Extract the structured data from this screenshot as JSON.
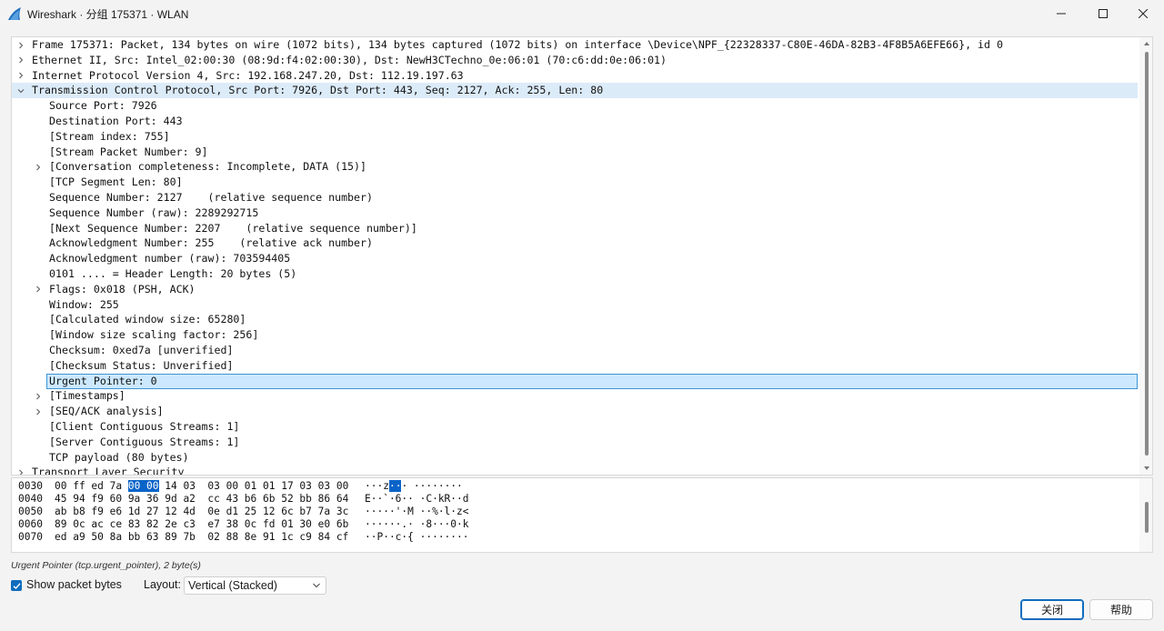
{
  "window": {
    "title": "Wireshark · 分组 175371 · WLAN",
    "accent_color": "#0f6cbd",
    "selection_color": "#cce8ff"
  },
  "tree": {
    "rows": [
      {
        "indent": 0,
        "expander": "right",
        "state": "none",
        "text": "Frame 175371: Packet, 134 bytes on wire (1072 bits), 134 bytes captured (1072 bits) on interface \\Device\\NPF_{22328337-C80E-46DA-82B3-4F8B5A6EFE66}, id 0"
      },
      {
        "indent": 0,
        "expander": "right",
        "state": "none",
        "text": "Ethernet II, Src: Intel_02:00:30 (08:9d:f4:02:00:30), Dst: NewH3CTechno_0e:06:01 (70:c6:dd:0e:06:01)"
      },
      {
        "indent": 0,
        "expander": "right",
        "state": "none",
        "text": "Internet Protocol Version 4, Src: 192.168.247.20, Dst: 112.19.197.63"
      },
      {
        "indent": 0,
        "expander": "down",
        "state": "hl",
        "text": "Transmission Control Protocol, Src Port: 7926, Dst Port: 443, Seq: 2127, Ack: 255, Len: 80"
      },
      {
        "indent": 1,
        "expander": "none",
        "state": "none",
        "text": "Source Port: 7926"
      },
      {
        "indent": 1,
        "expander": "none",
        "state": "none",
        "text": "Destination Port: 443"
      },
      {
        "indent": 1,
        "expander": "none",
        "state": "none",
        "text": "[Stream index: 755]"
      },
      {
        "indent": 1,
        "expander": "none",
        "state": "none",
        "text": "[Stream Packet Number: 9]"
      },
      {
        "indent": 1,
        "expander": "right",
        "state": "none",
        "text": "[Conversation completeness: Incomplete, DATA (15)]"
      },
      {
        "indent": 1,
        "expander": "none",
        "state": "none",
        "text": "[TCP Segment Len: 80]"
      },
      {
        "indent": 1,
        "expander": "none",
        "state": "none",
        "text": "Sequence Number: 2127    (relative sequence number)"
      },
      {
        "indent": 1,
        "expander": "none",
        "state": "none",
        "text": "Sequence Number (raw): 2289292715"
      },
      {
        "indent": 1,
        "expander": "none",
        "state": "none",
        "text": "[Next Sequence Number: 2207    (relative sequence number)]"
      },
      {
        "indent": 1,
        "expander": "none",
        "state": "none",
        "text": "Acknowledgment Number: 255    (relative ack number)"
      },
      {
        "indent": 1,
        "expander": "none",
        "state": "none",
        "text": "Acknowledgment number (raw): 703594405"
      },
      {
        "indent": 1,
        "expander": "none",
        "state": "none",
        "text": "0101 .... = Header Length: 20 bytes (5)"
      },
      {
        "indent": 1,
        "expander": "right",
        "state": "none",
        "text": "Flags: 0x018 (PSH, ACK)"
      },
      {
        "indent": 1,
        "expander": "none",
        "state": "none",
        "text": "Window: 255"
      },
      {
        "indent": 1,
        "expander": "none",
        "state": "none",
        "text": "[Calculated window size: 65280]"
      },
      {
        "indent": 1,
        "expander": "none",
        "state": "none",
        "text": "[Window size scaling factor: 256]"
      },
      {
        "indent": 1,
        "expander": "none",
        "state": "none",
        "text": "Checksum: 0xed7a [unverified]"
      },
      {
        "indent": 1,
        "expander": "none",
        "state": "none",
        "text": "[Checksum Status: Unverified]"
      },
      {
        "indent": 1,
        "expander": "none",
        "state": "sel",
        "text": "Urgent Pointer: 0"
      },
      {
        "indent": 1,
        "expander": "right",
        "state": "none",
        "text": "[Timestamps]"
      },
      {
        "indent": 1,
        "expander": "right",
        "state": "none",
        "text": "[SEQ/ACK analysis]"
      },
      {
        "indent": 1,
        "expander": "none",
        "state": "none",
        "text": "[Client Contiguous Streams: 1]"
      },
      {
        "indent": 1,
        "expander": "none",
        "state": "none",
        "text": "[Server Contiguous Streams: 1]"
      },
      {
        "indent": 1,
        "expander": "none",
        "state": "none",
        "text": "TCP payload (80 bytes)"
      },
      {
        "indent": 0,
        "expander": "right",
        "state": "none",
        "text": "Transport Layer Security"
      }
    ]
  },
  "hex": {
    "rows": [
      {
        "offset": "0030",
        "bytes_pre": "00 ff ed 7a ",
        "bytes_sel": "00 00",
        "bytes_post": " 14 03  03 00 01 01 17 03 03 00",
        "ascii_pre": "···z",
        "ascii_sel": "··",
        "ascii_post": "· ········"
      },
      {
        "offset": "0040",
        "bytes_pre": "45 94 f9 60 9a 36 9d a2  cc 43 b6 6b 52 bb 86 64",
        "bytes_sel": "",
        "bytes_post": "",
        "ascii_pre": "E··`·6·· ·C·kR··d",
        "ascii_sel": "",
        "ascii_post": ""
      },
      {
        "offset": "0050",
        "bytes_pre": "ab b8 f9 e6 1d 27 12 4d  0e d1 25 12 6c b7 7a 3c",
        "bytes_sel": "",
        "bytes_post": "",
        "ascii_pre": "·····'·M ··%·l·z<",
        "ascii_sel": "",
        "ascii_post": ""
      },
      {
        "offset": "0060",
        "bytes_pre": "89 0c ac ce 83 82 2e c3  e7 38 0c fd 01 30 e0 6b",
        "bytes_sel": "",
        "bytes_post": "",
        "ascii_pre": "······.· ·8···0·k",
        "ascii_sel": "",
        "ascii_post": ""
      },
      {
        "offset": "0070",
        "bytes_pre": "ed a9 50 8a bb 63 89 7b  02 88 8e 91 1c c9 84 cf",
        "bytes_sel": "",
        "bytes_post": "",
        "ascii_pre": "··P··c·{ ········",
        "ascii_sel": "",
        "ascii_post": ""
      }
    ]
  },
  "status": {
    "text": "Urgent Pointer (tcp.urgent_pointer), 2 byte(s)"
  },
  "options": {
    "show_bytes_label": "Show packet bytes",
    "show_bytes_checked": true,
    "layout_label": "Layout:",
    "layout_value": "Vertical (Stacked)"
  },
  "buttons": {
    "close_label": "关闭",
    "help_label": "帮助"
  }
}
